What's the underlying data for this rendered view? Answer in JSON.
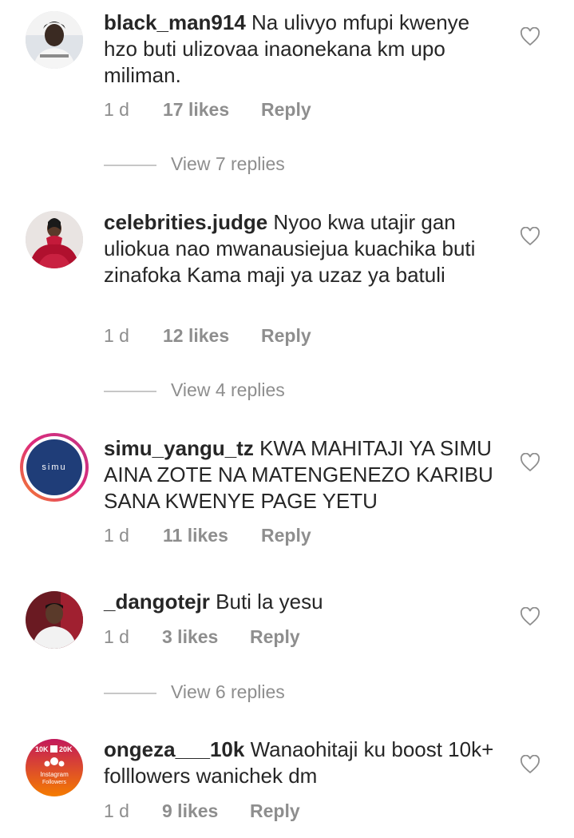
{
  "comments": [
    {
      "username": "black_man914",
      "text": "Na ulivyo mfupi kwenye hzo buti ulizovaa inaonekana km upo miliman.",
      "time": "1 d",
      "likes": "17 likes",
      "reply": "Reply",
      "view_replies": "View 7 replies"
    },
    {
      "username": "celebrities.judge",
      "text": "Nyoo kwa utajir gan uliokua nao mwanausiejua kuachika buti zinafoka Kama maji ya uzaz ya batuli",
      "time": "1 d",
      "likes": "12 likes",
      "reply": "Reply",
      "view_replies": "View 4 replies"
    },
    {
      "username": "simu_yangu_tz",
      "text": "KWA MAHITAJI YA SIMU AINA ZOTE NA MATENGENEZO KARIBU SANA KWENYE PAGE YETU",
      "time": "1 d",
      "likes": "11 likes",
      "reply": "Reply",
      "avatar_brand": "simu"
    },
    {
      "username": "_dangotejr",
      "text": "Buti la yesu",
      "time": "1 d",
      "likes": "3 likes",
      "reply": "Reply",
      "view_replies": "View 6 replies"
    },
    {
      "username": "ongeza___10k",
      "text": "Wanaohitaji ku boost 10k+ folllowers wanichek  dm",
      "time": "1 d",
      "likes": "9 likes",
      "reply": "Reply",
      "avatar_badge": [
        "10K",
        "20K",
        "Instagram",
        "Followers"
      ]
    }
  ],
  "icons": {
    "like": "heart-outline-icon"
  },
  "colors": {
    "text": "#262626",
    "meta": "#8e8e8e",
    "story_ring_start": "#f58529",
    "story_ring_end": "#c13584"
  }
}
